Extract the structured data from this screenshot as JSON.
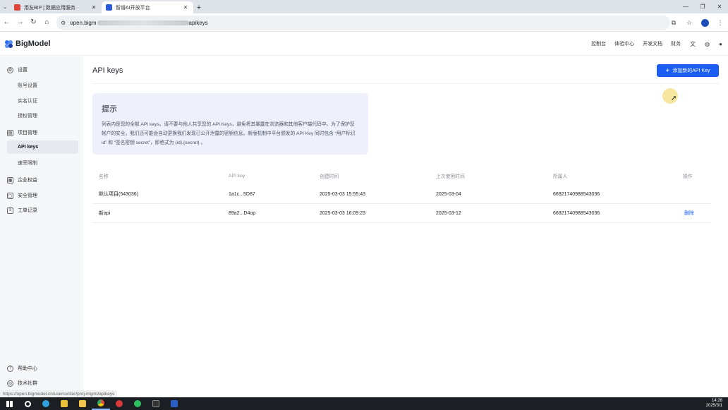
{
  "browser": {
    "tab_dropdown_icon": "chevron-down",
    "tabs": [
      {
        "title": "用友BIP | 数据应用服务",
        "active": false
      },
      {
        "title": "智谱AI开放平台",
        "active": true
      }
    ],
    "url_prefix": "open.bigm",
    "url_suffix": "apikeys",
    "status_url": "https://open.bigmodel.cn/usercenter/proj-mgmt/apikeys"
  },
  "app": {
    "logo_text": "BigModel",
    "topnav": [
      "控制台",
      "体验中心",
      "开发文档",
      "财务"
    ]
  },
  "sidebar": {
    "groups": [
      {
        "label": "设置",
        "icon": "settings-icon",
        "items": [
          "账号设置",
          "实名认证",
          "授权管理"
        ]
      },
      {
        "label": "项目管理",
        "icon": "project-icon",
        "items": [
          "API keys",
          "速率限制"
        ]
      },
      {
        "label": "企业权益",
        "icon": "enterprise-icon",
        "items": []
      },
      {
        "label": "安全管理",
        "icon": "lock-icon",
        "items": []
      },
      {
        "label": "工单记录",
        "icon": "ticket-icon",
        "items": []
      }
    ],
    "bottom": [
      "帮助中心",
      "技术社群"
    ]
  },
  "main": {
    "title": "API keys",
    "add_button": "添加新的API Key",
    "tip": {
      "title": "提示",
      "body": "列表内是您的全部 API keys。请不要与他人共享您的 API Keys，避免将其暴露在浏览器和其他客户端代码中。为了保护您帐户的安全，我们还可能会自动更换我们发现已公开泄露的密钥信息。新版机制中平台颁发的 API Key 同时包含 “用户标识 id” 和 “签名密钥 secret”，即格式为 {id}.{secret} 。"
    },
    "table": {
      "columns": [
        "名称",
        "API key",
        "创建时间",
        "上次使用时间",
        "所属人",
        "操作"
      ],
      "rows": [
        {
          "name": "默认项目(543036)",
          "key": "1a1c...5D87",
          "created": "2025-03-03 15:55:43",
          "last_used": "2025-03-04",
          "owner": "669217409885430​36",
          "action": ""
        },
        {
          "name": "新api",
          "key": "89a2...D4op",
          "created": "2025-03-03 16:09:23",
          "last_used": "2025-03-12",
          "owner": "66921740988543036",
          "action": "删除"
        }
      ]
    }
  },
  "taskbar": {
    "time": "14:28",
    "date": "2025/3/1"
  }
}
